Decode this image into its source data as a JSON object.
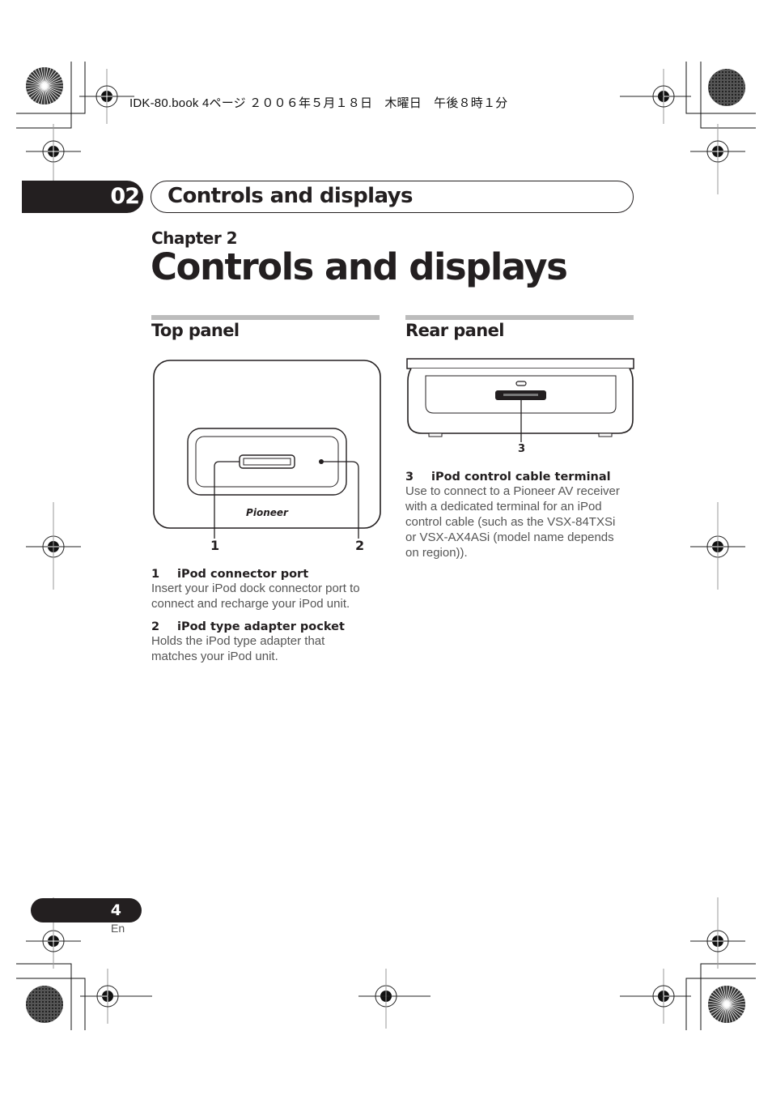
{
  "print_header": "IDK-80.book  4ページ  ２００６年５月１８日　木曜日　午後８時１分",
  "chapter_tab": {
    "number": "02",
    "title": "Controls and displays"
  },
  "chapter_label": "Chapter 2",
  "page_title": "Controls and displays",
  "sections": {
    "top_panel": {
      "title": "Top panel",
      "figure": {
        "brand_logo": "Pioneer",
        "callouts": [
          "1",
          "2"
        ]
      },
      "items": [
        {
          "number": "1",
          "heading": "iPod connector port",
          "description": [
            "Insert your iPod dock connector port to",
            "connect and recharge your iPod unit."
          ]
        },
        {
          "number": "2",
          "heading": "iPod type adapter pocket",
          "description": [
            "Holds the iPod type adapter that",
            "matches your iPod unit."
          ]
        }
      ]
    },
    "rear_panel": {
      "title": "Rear panel",
      "figure": {
        "callouts": [
          "3"
        ]
      },
      "items": [
        {
          "number": "3",
          "heading": "iPod control cable terminal",
          "description": [
            "Use to connect to a Pioneer AV receiver",
            "with a dedicated terminal for an iPod",
            "control cable (such as the VSX-84TXSi",
            "or VSX-AX4ASi (model name depends",
            "on region))."
          ]
        }
      ]
    }
  },
  "folio": {
    "page_number": "4",
    "language": "En"
  }
}
